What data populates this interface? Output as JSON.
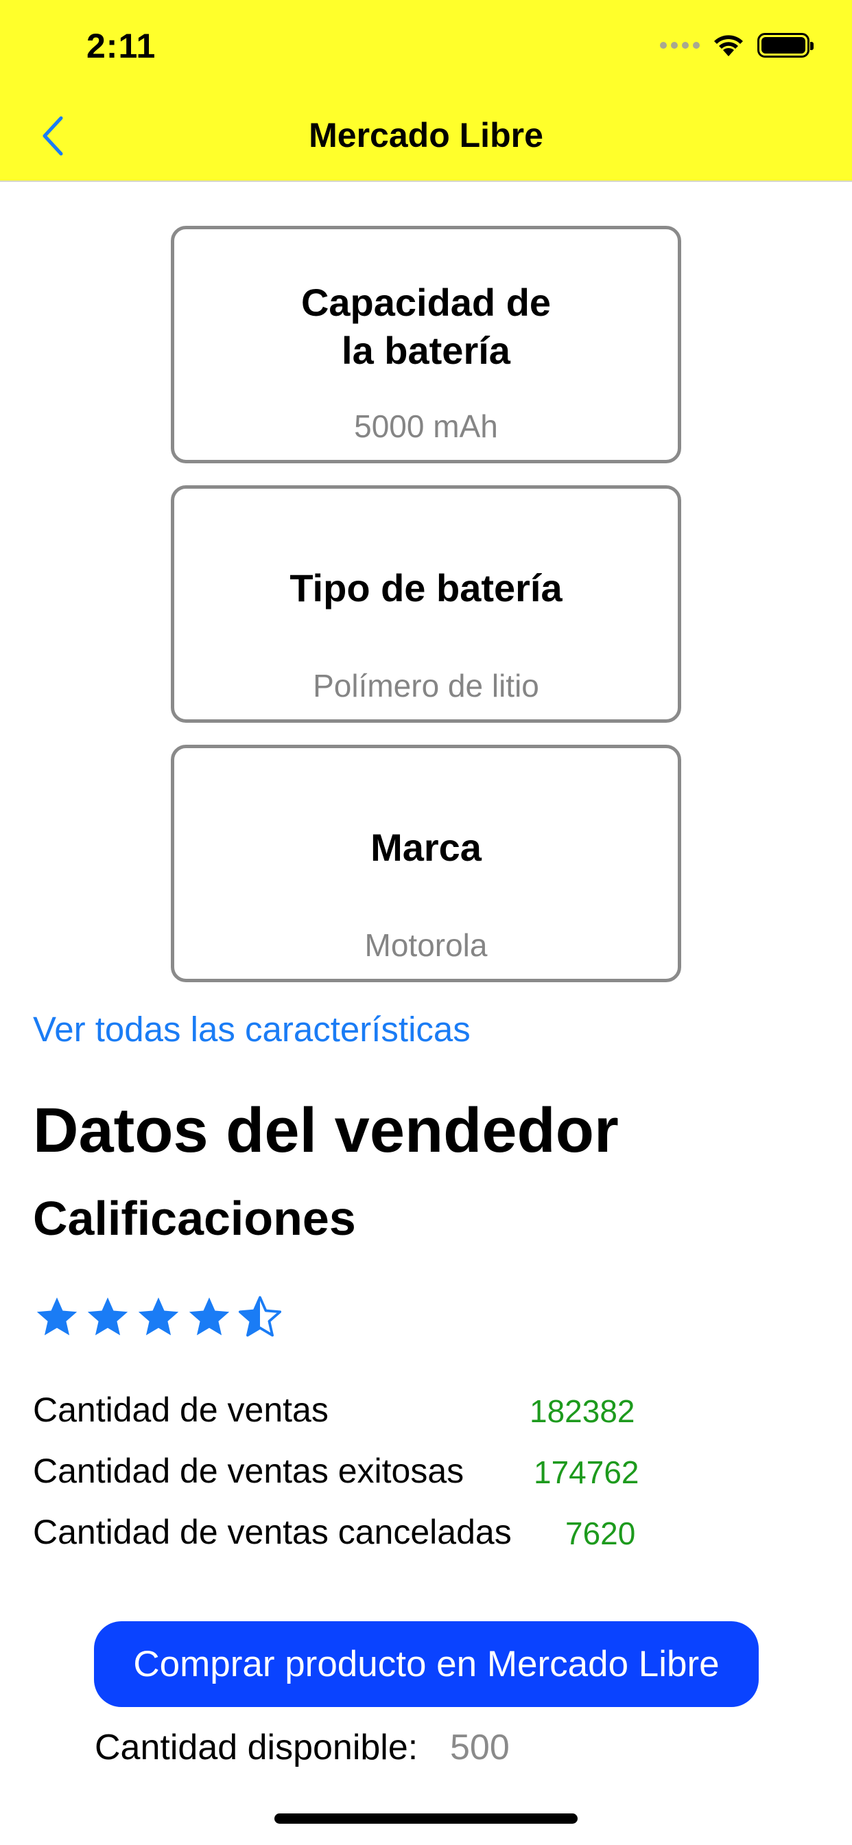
{
  "status_bar": {
    "time": "2:11"
  },
  "nav": {
    "title": "Mercado Libre"
  },
  "features": [
    {
      "title": "Capacidad de\nla batería",
      "value": "5000 mAh"
    },
    {
      "title": "Tipo de batería",
      "value": "Polímero de litio"
    },
    {
      "title": "Marca",
      "value": "Motorola"
    }
  ],
  "see_all_link": "Ver todas las características",
  "seller": {
    "heading": "Datos del vendedor",
    "ratings_heading": "Calificaciones",
    "rating_stars": 4.5,
    "rating_max": 5,
    "stats": [
      {
        "label": "Cantidad de ventas",
        "value": "182382"
      },
      {
        "label": "Cantidad de ventas exitosas",
        "value": "174762"
      },
      {
        "label": "Cantidad de ventas canceladas",
        "value": "7620"
      }
    ]
  },
  "buy_button": "Comprar producto en Mercado Libre",
  "availability": {
    "label": "Cantidad disponible:",
    "value": "500"
  },
  "colors": {
    "header": "#ffff2b",
    "accent": "#1a7cf5",
    "button": "#0a43ff",
    "stat_value": "#1d9a1d",
    "card_border": "#8a8a8a"
  },
  "icons": [
    "back-chevron-icon",
    "wifi-icon",
    "battery-icon",
    "star-icon",
    "half-star-icon"
  ]
}
